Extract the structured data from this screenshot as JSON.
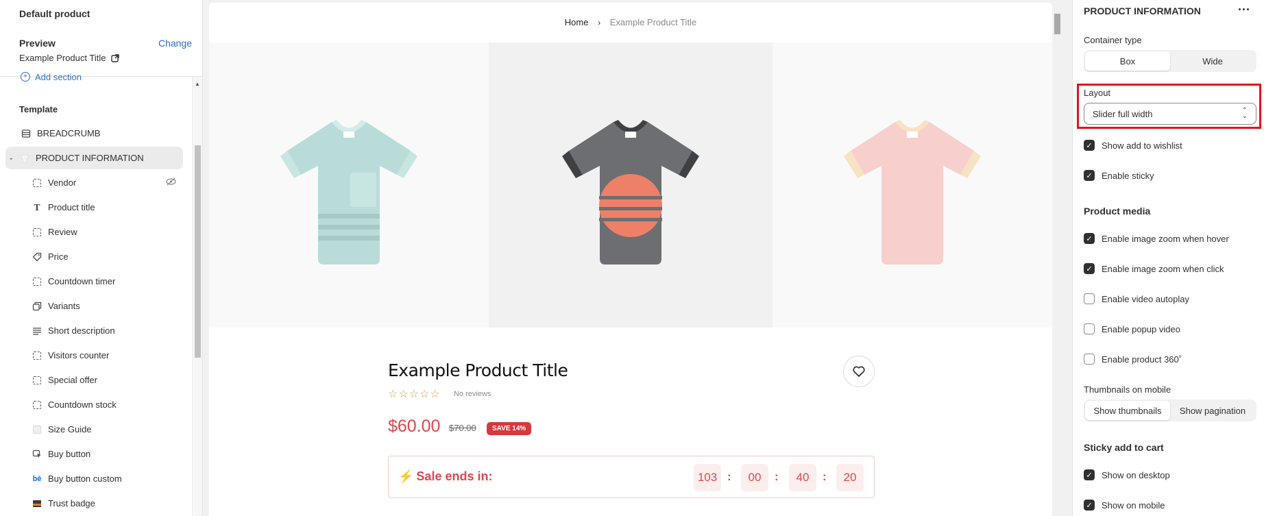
{
  "left_panel": {
    "page_title": "Default product",
    "preview_label": "Preview",
    "change_link": "Change",
    "preview_value": "Example Product Title",
    "add_section": "Add section",
    "template_label": "Template",
    "items": [
      {
        "label": "BREADCRUMB",
        "icon": "breadcrumb-icon"
      },
      {
        "label": "PRODUCT INFORMATION",
        "icon": "product-info-icon",
        "selected": true
      },
      {
        "label": "Vendor",
        "icon": "block-icon",
        "hidden": true
      },
      {
        "label": "Product title",
        "icon": "text-icon"
      },
      {
        "label": "Review",
        "icon": "block-icon"
      },
      {
        "label": "Price",
        "icon": "price-tag-icon"
      },
      {
        "label": "Countdown timer",
        "icon": "block-icon"
      },
      {
        "label": "Variants",
        "icon": "variants-icon"
      },
      {
        "label": "Short description",
        "icon": "lines-icon"
      },
      {
        "label": "Visitors counter",
        "icon": "block-icon"
      },
      {
        "label": "Special offer",
        "icon": "block-icon"
      },
      {
        "label": "Countdown stock",
        "icon": "block-icon"
      },
      {
        "label": "Size Guide",
        "icon": "image-icon"
      },
      {
        "label": "Buy button",
        "icon": "cursor-icon"
      },
      {
        "label": "Buy button custom",
        "icon": "behance-icon"
      },
      {
        "label": "Trust badge",
        "icon": "image-icon"
      }
    ]
  },
  "preview": {
    "breadcrumb_home": "Home",
    "breadcrumb_sep": "›",
    "breadcrumb_current": "Example Product Title",
    "product_title": "Example Product Title",
    "stars": "☆☆☆☆☆",
    "reviews": "No reviews",
    "price": "$60.00",
    "compare_price": "$70.00",
    "save_badge": "SAVE 14%",
    "sale_label": "Sale ends in:",
    "timer": {
      "days": "103",
      "hours": "00",
      "minutes": "40",
      "seconds": "20",
      "separator": ":"
    },
    "colors": {
      "price": "#e0474e",
      "tee_left": "#b9dcd9",
      "tee_mid": "#6d6e72",
      "tee_right": "#f7cfcd"
    }
  },
  "right_panel": {
    "title": "PRODUCT INFORMATION",
    "container_type_label": "Container type",
    "container_options": [
      "Box",
      "Wide"
    ],
    "container_selected": "Box",
    "layout_label": "Layout",
    "layout_value": "Slider full width",
    "show_wishlist": "Show add to wishlist",
    "enable_sticky": "Enable sticky",
    "product_media_heading": "Product media",
    "zoom_hover": "Enable image zoom when hover",
    "zoom_click": "Enable image zoom when click",
    "video_autoplay": "Enable video autoplay",
    "popup_video": "Enable popup video",
    "product_360": "Enable product 360˚",
    "thumbs_label": "Thumbnails on mobile",
    "thumb_options": [
      "Show thumbnails",
      "Show pagination"
    ],
    "thumb_selected": "Show thumbnails",
    "sticky_heading": "Sticky add to cart",
    "show_desktop": "Show on desktop",
    "show_mobile": "Show on mobile",
    "checkboxes": {
      "wishlist": true,
      "sticky": true,
      "zoom_hover": true,
      "zoom_click": true,
      "autoplay": false,
      "popup": false,
      "p360": false,
      "desktop": true,
      "mobile": true
    }
  }
}
